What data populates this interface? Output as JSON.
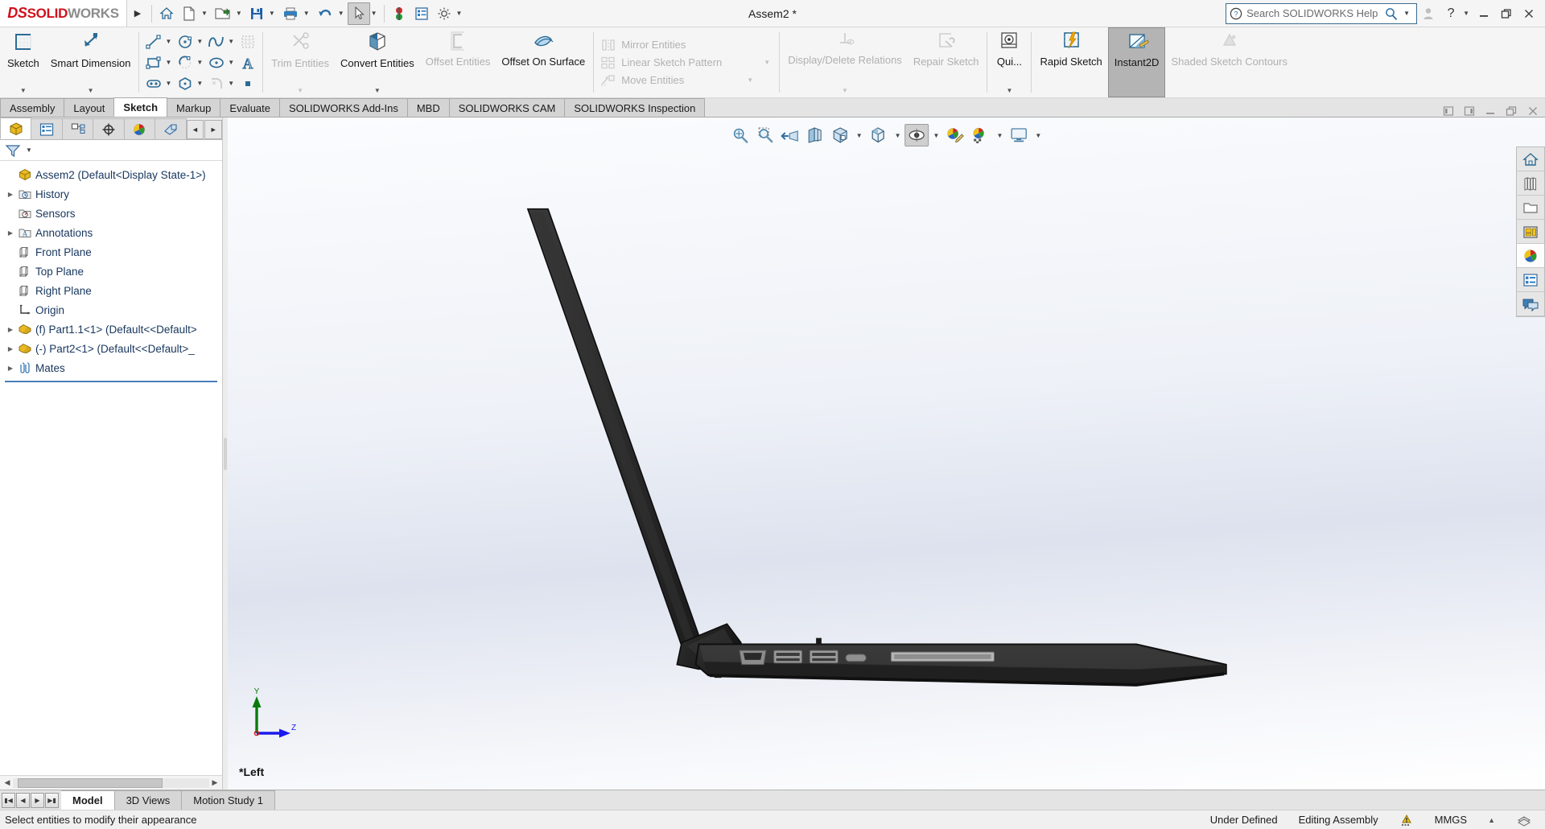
{
  "titlebar": {
    "logo_ds": "DS",
    "logo_solid": "SOLID",
    "logo_works": "WORKS",
    "document_title": "Assem2 *",
    "expand_label": "menu-expand",
    "quick_access": [
      {
        "name": "home-icon",
        "label": "Home"
      },
      {
        "name": "new-document-icon",
        "label": "New"
      },
      {
        "name": "open-folder-icon",
        "label": "Open"
      },
      {
        "name": "save-icon",
        "label": "Save"
      },
      {
        "name": "print-icon",
        "label": "Print"
      },
      {
        "name": "undo-icon",
        "label": "Undo"
      },
      {
        "name": "select-cursor-icon",
        "label": "Select"
      },
      {
        "name": "rebuild-icon",
        "label": "Rebuild"
      },
      {
        "name": "file-properties-icon",
        "label": "File Properties"
      },
      {
        "name": "options-gear-icon",
        "label": "Options"
      }
    ],
    "search": {
      "placeholder": "Search SOLIDWORKS Help",
      "value": "Search SOLIDWORKS Help",
      "help_icon": "question-circle-icon",
      "magnifier_icon": "magnifier-icon"
    },
    "window_controls": [
      {
        "name": "user-account-icon",
        "label": "Account"
      },
      {
        "name": "help-icon",
        "label": "?"
      },
      {
        "name": "minimize-button",
        "label": "Minimize"
      },
      {
        "name": "restore-button",
        "label": "Restore"
      },
      {
        "name": "close-button",
        "label": "Close"
      }
    ]
  },
  "ribbon": {
    "commands": [
      {
        "label": "Sketch",
        "icon": "sketch-icon",
        "disabled": false,
        "dropdown": true
      },
      {
        "label": "Smart Dimension",
        "icon": "smart-dimension-icon",
        "disabled": false,
        "dropdown": true
      },
      {
        "label": "Trim Entities",
        "icon": "trim-entities-icon",
        "disabled": true,
        "dropdown": true
      },
      {
        "label": "Convert Entities",
        "icon": "convert-entities-icon",
        "disabled": false,
        "dropdown": true
      },
      {
        "label": "Offset Entities",
        "icon": "offset-entities-icon",
        "disabled": true,
        "dropdown": false
      },
      {
        "label": "Offset On Surface",
        "icon": "offset-on-surface-icon",
        "disabled": false,
        "dropdown": false
      },
      {
        "label": "Display/Delete Relations",
        "icon": "display-delete-relations-icon",
        "disabled": true,
        "dropdown": true
      },
      {
        "label": "Repair Sketch",
        "icon": "repair-sketch-icon",
        "disabled": true,
        "dropdown": false
      },
      {
        "label": "Qui...",
        "icon": "quick-snaps-icon",
        "disabled": false,
        "dropdown": true
      },
      {
        "label": "Rapid Sketch",
        "icon": "rapid-sketch-icon",
        "disabled": false,
        "dropdown": false
      },
      {
        "label": "Instant2D",
        "icon": "instant2d-icon",
        "disabled": false,
        "selected": true,
        "dropdown": false
      },
      {
        "label": "Shaded Sketch Contours",
        "icon": "shaded-sketch-contours-icon",
        "disabled": true,
        "dropdown": false
      }
    ],
    "sketch_tools_row1": [
      {
        "name": "line-icon",
        "label": "Line",
        "dropdown": true
      },
      {
        "name": "circle-icon",
        "label": "Circle",
        "dropdown": true
      },
      {
        "name": "spline-icon",
        "label": "Spline",
        "dropdown": true
      },
      {
        "name": "trim-grid-icon",
        "label": "Sketch Pattern",
        "dropdown": false
      }
    ],
    "sketch_tools_row2": [
      {
        "name": "rectangle-icon",
        "label": "Rectangle",
        "dropdown": true
      },
      {
        "name": "arc-icon",
        "label": "Arc",
        "dropdown": true
      },
      {
        "name": "ellipse-icon",
        "label": "Ellipse",
        "dropdown": true
      },
      {
        "name": "text-icon",
        "label": "Text",
        "dropdown": false
      }
    ],
    "sketch_tools_row3": [
      {
        "name": "slot-icon",
        "label": "Slot",
        "dropdown": true
      },
      {
        "name": "polygon-icon",
        "label": "Polygon",
        "dropdown": false
      },
      {
        "name": "fillet-icon",
        "label": "Sketch Fillet",
        "dropdown": true,
        "disabled": true
      },
      {
        "name": "point-icon",
        "label": "Point",
        "dropdown": false
      }
    ],
    "pattern_tools": [
      {
        "name": "mirror-entities-icon",
        "label": "Mirror Entities",
        "dropdown": false,
        "disabled": true
      },
      {
        "name": "linear-sketch-pattern-icon",
        "label": "Linear Sketch Pattern",
        "dropdown": true,
        "disabled": true
      },
      {
        "name": "move-entities-icon",
        "label": "Move Entities",
        "dropdown": true,
        "disabled": true
      }
    ]
  },
  "tabs": {
    "items": [
      {
        "label": "Assembly",
        "active": false
      },
      {
        "label": "Layout",
        "active": false
      },
      {
        "label": "Sketch",
        "active": true
      },
      {
        "label": "Markup",
        "active": false
      },
      {
        "label": "Evaluate",
        "active": false
      },
      {
        "label": "SOLIDWORKS Add-Ins",
        "active": false
      },
      {
        "label": "MBD",
        "active": false
      },
      {
        "label": "SOLIDWORKS CAM",
        "active": false
      },
      {
        "label": "SOLIDWORKS Inspection",
        "active": false
      }
    ],
    "window_controls": [
      {
        "name": "pin-left-button",
        "label": "Pin Left"
      },
      {
        "name": "pin-right-button",
        "label": "Pin Right"
      },
      {
        "name": "doc-minimize-button",
        "label": "Minimize"
      },
      {
        "name": "doc-restore-button",
        "label": "Restore"
      },
      {
        "name": "doc-close-button",
        "label": "Close"
      }
    ]
  },
  "feature_manager": {
    "panel_tabs": [
      {
        "name": "featuremanager-tab",
        "label": "FeatureManager Design Tree",
        "active": true
      },
      {
        "name": "propertymanager-tab",
        "label": "PropertyManager",
        "active": false
      },
      {
        "name": "configurationmanager-tab",
        "label": "ConfigurationManager",
        "active": false
      },
      {
        "name": "dimxpertmanager-tab",
        "label": "DimXpertManager",
        "active": false
      },
      {
        "name": "displaymanager-tab",
        "label": "DisplayManager",
        "active": false
      },
      {
        "name": "cam-tab",
        "label": "CAM Feature Tree",
        "active": false
      }
    ],
    "nav_prev": "◄",
    "nav_next": "►",
    "filter_label": "filter-icon",
    "tree": [
      {
        "label": "Assem2  (Default<Display State-1>)",
        "icon": "assembly-icon",
        "indent": 0,
        "expander": "none",
        "root": true
      },
      {
        "label": "History",
        "icon": "history-icon",
        "indent": 1,
        "expander": "collapsed"
      },
      {
        "label": "Sensors",
        "icon": "sensors-icon",
        "indent": 1,
        "expander": "none"
      },
      {
        "label": "Annotations",
        "icon": "annotations-icon",
        "indent": 1,
        "expander": "collapsed"
      },
      {
        "label": "Front Plane",
        "icon": "plane-icon",
        "indent": 1,
        "expander": "none"
      },
      {
        "label": "Top Plane",
        "icon": "plane-icon",
        "indent": 1,
        "expander": "none"
      },
      {
        "label": "Right Plane",
        "icon": "plane-icon",
        "indent": 1,
        "expander": "none"
      },
      {
        "label": "Origin",
        "icon": "origin-icon",
        "indent": 1,
        "expander": "none"
      },
      {
        "label": "(f) Part1.1<1>  (Default<<Default>",
        "icon": "part-icon",
        "indent": 1,
        "expander": "collapsed"
      },
      {
        "label": "(-) Part2<1>  (Default<<Default>_",
        "icon": "part-icon",
        "indent": 1,
        "expander": "collapsed"
      },
      {
        "label": "Mates",
        "icon": "mates-icon",
        "indent": 1,
        "expander": "collapsed"
      }
    ]
  },
  "viewport": {
    "view_label": "*Left",
    "triad": {
      "y_axis": "Y",
      "z_axis": "Z"
    },
    "toolbar": [
      {
        "name": "zoom-to-fit-icon",
        "label": "Zoom to Fit"
      },
      {
        "name": "zoom-to-area-icon",
        "label": "Zoom to Area"
      },
      {
        "name": "previous-view-icon",
        "label": "Previous View"
      },
      {
        "name": "section-view-icon",
        "label": "Section View"
      },
      {
        "name": "view-orientation-icon",
        "label": "View Orientation"
      },
      {
        "name": "display-style-icon",
        "label": "Display Style",
        "dropdown": true
      },
      {
        "name": "hide-show-items-icon",
        "label": "Hide/Show Items",
        "dropdown": true
      },
      {
        "name": "edit-appearance-icon",
        "label": "Edit Appearance",
        "pressed": true,
        "dropdown": true
      },
      {
        "name": "apply-scene-icon",
        "label": "Apply Scene"
      },
      {
        "name": "view-settings-icon",
        "label": "View Settings",
        "dropdown": true
      },
      {
        "name": "viewport-layout-icon",
        "label": "Viewport Layout",
        "dropdown": true
      }
    ],
    "task_pane": [
      {
        "name": "solidworks-resources-icon",
        "label": "SOLIDWORKS Resources"
      },
      {
        "name": "design-library-icon",
        "label": "Design Library"
      },
      {
        "name": "file-explorer-icon",
        "label": "File Explorer"
      },
      {
        "name": "view-palette-icon",
        "label": "View Palette"
      },
      {
        "name": "appearances-scenes-icon",
        "label": "Appearances, Scenes and Decals",
        "highlight": true
      },
      {
        "name": "custom-properties-icon",
        "label": "Custom Properties"
      },
      {
        "name": "solidworks-forum-icon",
        "label": "SOLIDWORKS Forum"
      }
    ]
  },
  "bottom": {
    "nav_buttons": [
      {
        "name": "first-tab-button",
        "label": "⏮"
      },
      {
        "name": "prev-tab-button",
        "label": "◀"
      },
      {
        "name": "next-tab-button",
        "label": "▶"
      },
      {
        "name": "last-tab-button",
        "label": "⏭"
      }
    ],
    "tabs": [
      {
        "label": "Model",
        "active": true
      },
      {
        "label": "3D Views",
        "active": false
      },
      {
        "label": "Motion Study 1",
        "active": false
      }
    ]
  },
  "statusbar": {
    "message": "Select entities to modify their appearance",
    "state": "Under Defined",
    "edit_mode": "Editing Assembly",
    "overdefined_icon": "rebuild-warning-icon",
    "units": "MMGS",
    "units_caret": "▲",
    "tools_icon": "layers-icon"
  },
  "colors": {
    "brand_red": "#d0111b",
    "tree_text": "#17365d",
    "accent_blue": "#3a6c91",
    "selected_gray": "#b4b4b4",
    "laptop_body": "#2b2b2b",
    "laptop_dark": "#1a1a1a",
    "port_gray": "#8a8a8a",
    "axis_y": "#0a7a0a",
    "axis_z": "#1a1aee"
  }
}
